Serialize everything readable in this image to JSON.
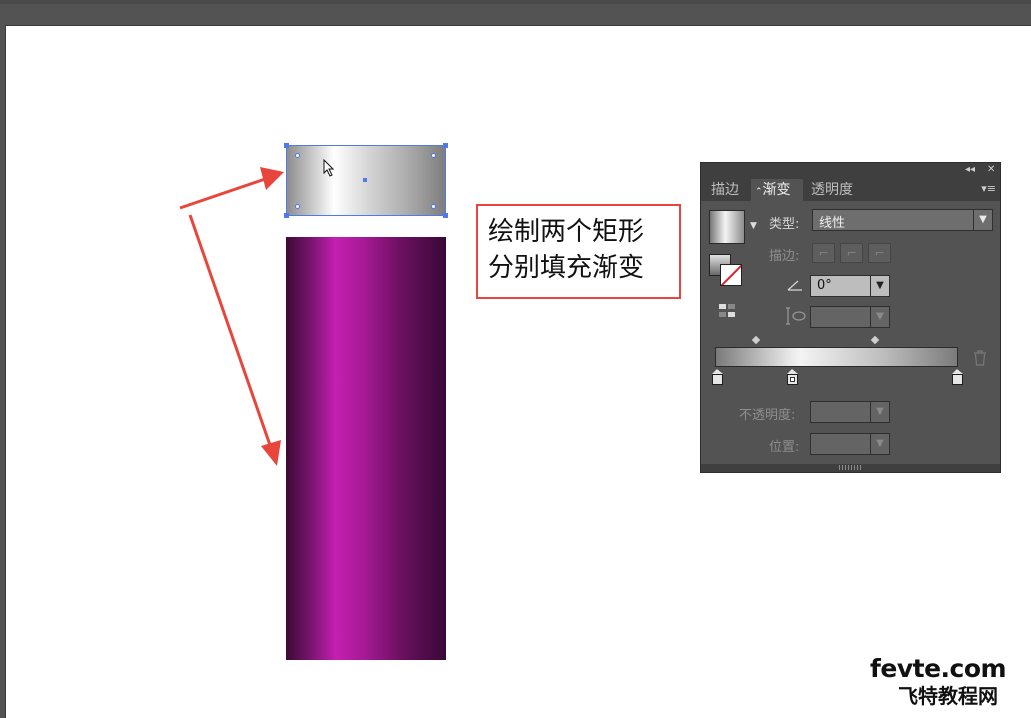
{
  "callout": {
    "line1": "绘制两个矩形",
    "line2": "分别填充渐变"
  },
  "panel": {
    "tabs": [
      "描边",
      "渐变",
      "透明度"
    ],
    "active_tab": "渐变",
    "type_label": "类型:",
    "type_value": "线性",
    "stroke_label": "描边:",
    "angle_value": "0°",
    "opacity_label": "不透明度:",
    "position_label": "位置:"
  },
  "watermark": {
    "line1": "fevte.com",
    "line2": "飞特教程网"
  },
  "colors": {
    "arrow": "#e8463d",
    "selection": "#4f7ae8",
    "purple_main": "#c41fb0",
    "purple_dark": "#3c0a36"
  }
}
